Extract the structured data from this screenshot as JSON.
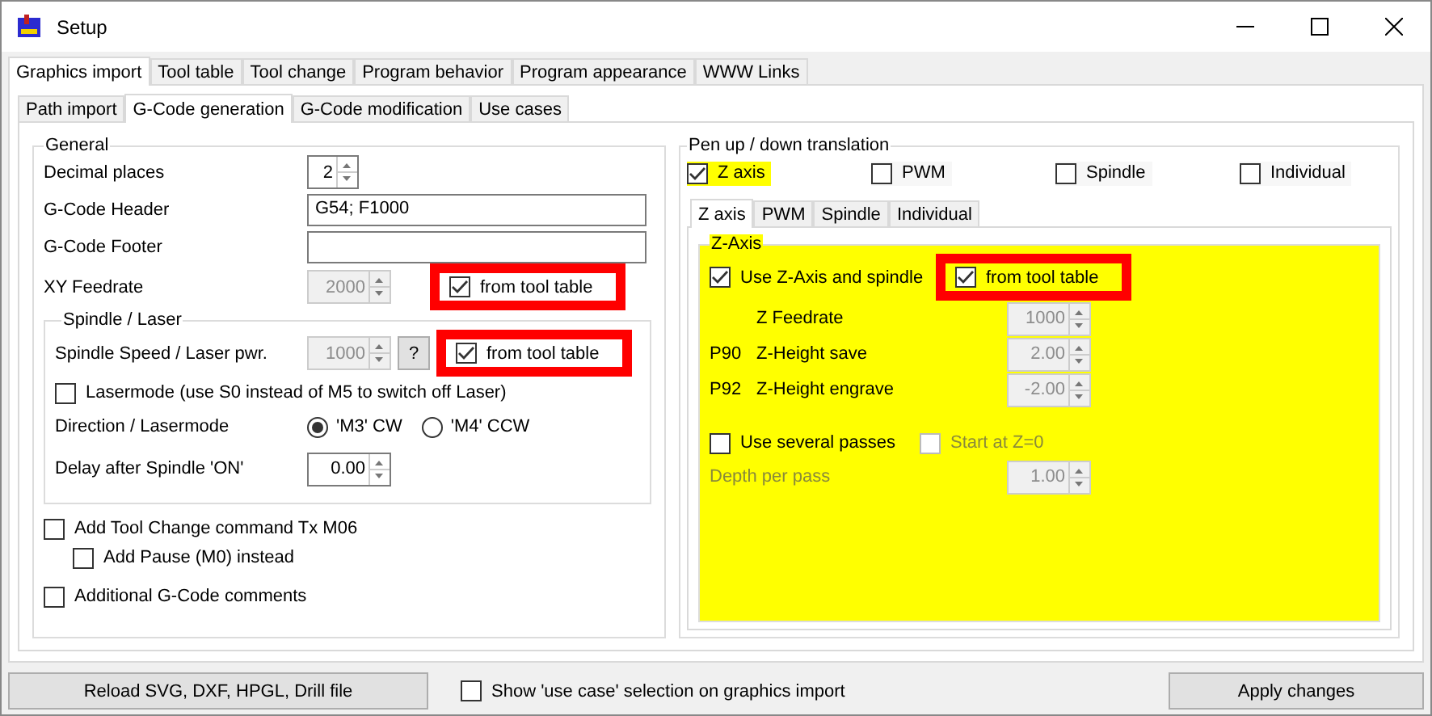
{
  "window": {
    "title": "Setup"
  },
  "tabs": [
    {
      "label": "Graphics import",
      "selected": true
    },
    {
      "label": "Tool table",
      "selected": false
    },
    {
      "label": "Tool change",
      "selected": false
    },
    {
      "label": "Program behavior",
      "selected": false
    },
    {
      "label": "Program appearance",
      "selected": false
    },
    {
      "label": "WWW Links",
      "selected": false
    }
  ],
  "subtabs": [
    {
      "label": "Path import",
      "selected": false
    },
    {
      "label": "G-Code generation",
      "selected": true
    },
    {
      "label": "G-Code modification",
      "selected": false
    },
    {
      "label": "Use cases",
      "selected": false
    }
  ],
  "general": {
    "title": "General",
    "decimal_places": {
      "label": "Decimal places",
      "value": "2"
    },
    "header": {
      "label": "G-Code Header",
      "value": "G54; F1000"
    },
    "footer": {
      "label": "G-Code Footer"
    },
    "xy_feedrate": {
      "label": "XY Feedrate",
      "value": "2000",
      "disabled": true,
      "from_tool_table": {
        "label": "from tool table",
        "checked": true,
        "highlighted": true
      }
    },
    "spindle": {
      "title": "Spindle / Laser",
      "speed": {
        "label": "Spindle Speed / Laser pwr.",
        "value": "1000",
        "disabled": true,
        "help": "?",
        "from_tool_table": {
          "label": "from tool table",
          "checked": true,
          "highlighted": true
        }
      },
      "lasermode": {
        "label": "Lasermode (use S0 instead of M5 to switch off Laser)",
        "checked": false
      },
      "direction": {
        "label": "Direction / Lasermode",
        "options": [
          {
            "label": "'M3' CW",
            "selected": true
          },
          {
            "label": "'M4' CCW",
            "selected": false
          }
        ]
      },
      "delay": {
        "label": "Delay after Spindle 'ON'",
        "value": "0.00",
        "disabled": false
      }
    },
    "options": [
      {
        "label": "Add Tool Change command Tx M06",
        "checked": false,
        "children": [
          {
            "label": "Add Pause (M0) instead",
            "checked": false
          }
        ]
      },
      {
        "label": "Additional G-Code comments",
        "checked": false
      }
    ]
  },
  "pen": {
    "title": "Pen up / down translation",
    "modes": [
      {
        "label": "Z axis",
        "checked": true,
        "highlighted": true
      },
      {
        "label": "PWM",
        "checked": false,
        "highlighted": false
      },
      {
        "label": "Spindle",
        "checked": false,
        "highlighted": false
      },
      {
        "label": "Individual",
        "checked": false,
        "highlighted": false
      }
    ],
    "tabs": [
      {
        "label": "Z axis",
        "selected": true
      },
      {
        "label": "PWM",
        "selected": false
      },
      {
        "label": "Spindle",
        "selected": false
      },
      {
        "label": "Individual",
        "selected": false
      }
    ],
    "zaxis": {
      "title": "Z-Axis",
      "highlighted": true,
      "use": {
        "label": "Use Z-Axis and spindle",
        "checked": true
      },
      "from_tool_table": {
        "label": "from tool table",
        "checked": true,
        "highlighted": true
      },
      "rows": [
        {
          "label": "Z Feedrate",
          "value": "1000",
          "disabled": true
        },
        {
          "code": "P90",
          "label": "Z-Height save",
          "value": "2.00",
          "disabled": true
        },
        {
          "code": "P92",
          "label": "Z-Height engrave",
          "value": "-2.00",
          "disabled": true
        }
      ],
      "passes": {
        "label": "Use several passes",
        "checked": false,
        "disabled": false
      },
      "start": {
        "label": "Start at Z=0",
        "checked": false,
        "disabled": true
      },
      "depth": {
        "label": "Depth per pass",
        "value": "1.00",
        "disabled": true
      }
    }
  },
  "bottom": {
    "reload": "Reload SVG, DXF, HPGL, Drill file",
    "show_use_case": {
      "label": "Show 'use case' selection on graphics import",
      "checked": false
    },
    "apply": "Apply changes"
  }
}
